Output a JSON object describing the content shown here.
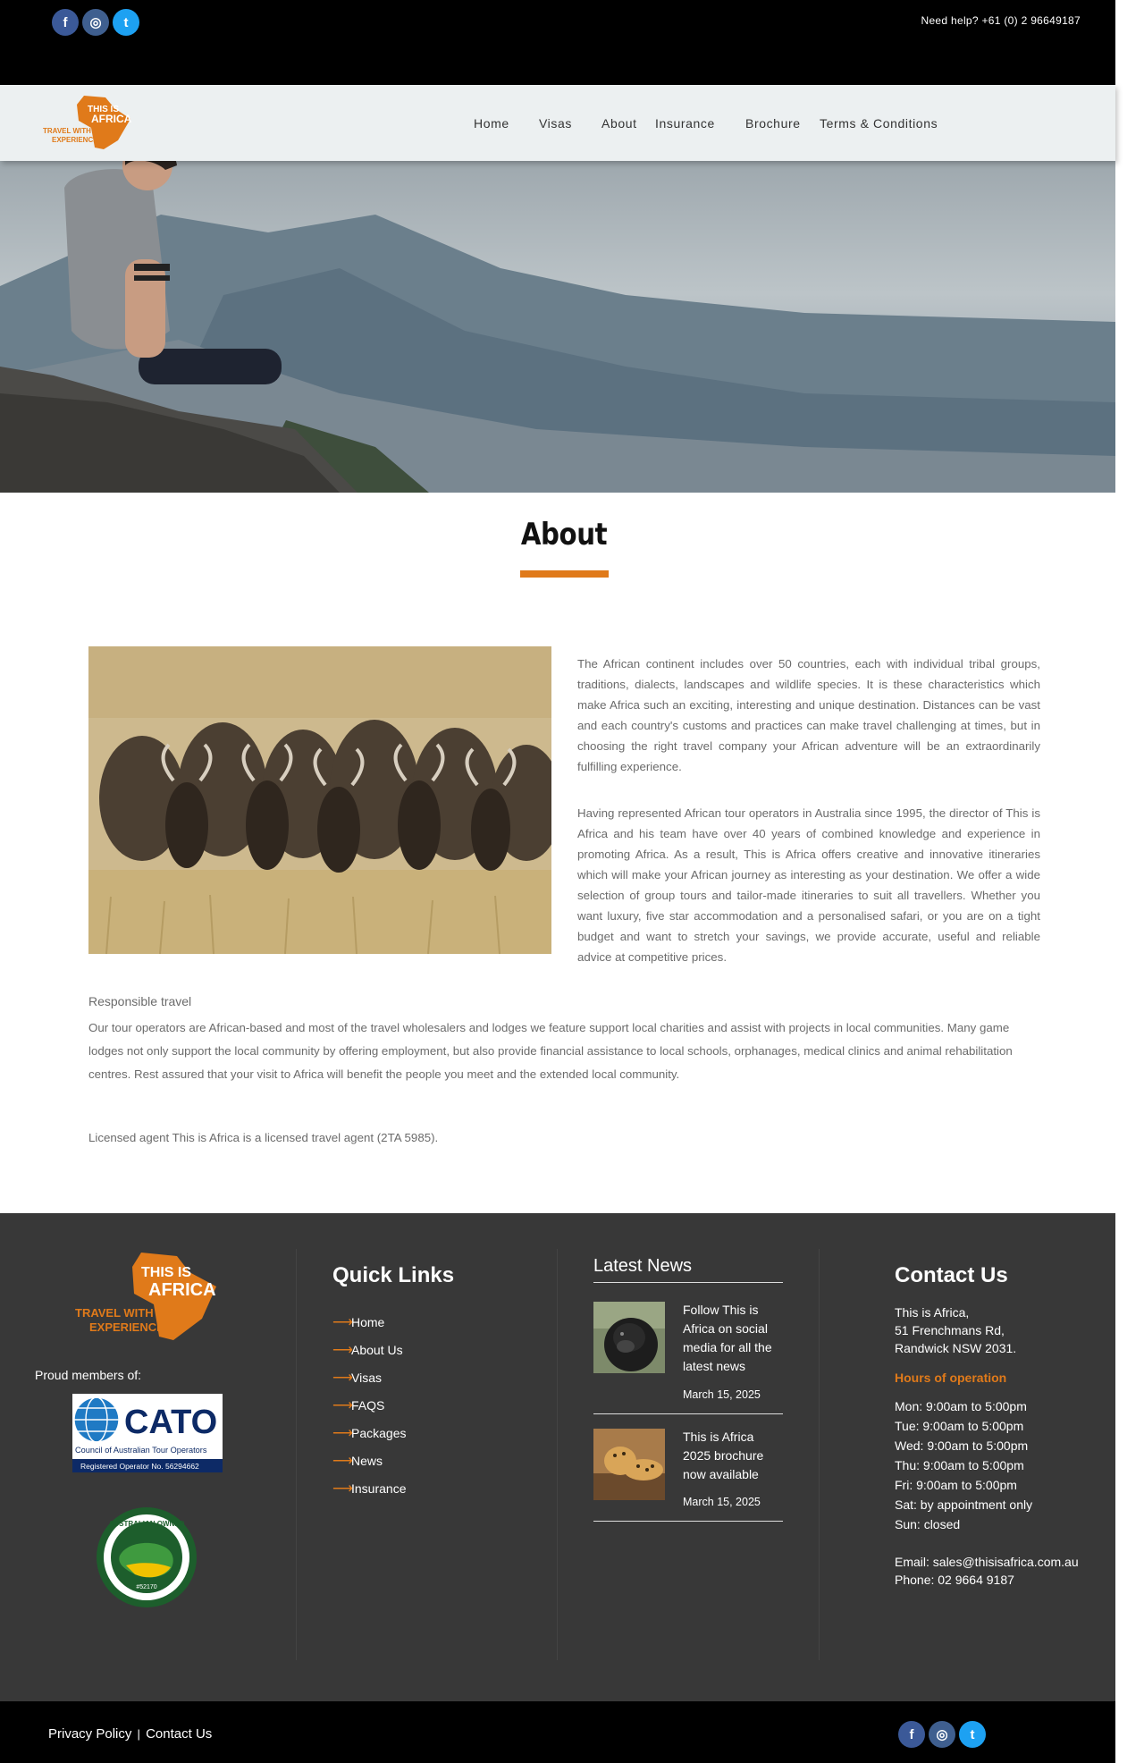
{
  "topbar": {
    "social": [
      {
        "icon": "facebook-icon",
        "glyph": "f"
      },
      {
        "icon": "instagram-icon",
        "glyph": "◎"
      },
      {
        "icon": "twitter-icon",
        "glyph": "t"
      }
    ],
    "help_text": "Need help? +61 (0) 2 96649187"
  },
  "brand": {
    "logo_line1": "THIS IS",
    "logo_line2": "AFRICA",
    "tagline1": "TRAVEL WITH",
    "tagline2": "EXPERIENCE",
    "accent": "#e07a1a"
  },
  "nav": {
    "items": [
      "Home",
      "Visas",
      "About",
      "Insurance",
      "Brochure",
      "Terms & Conditions"
    ]
  },
  "about": {
    "title": "About",
    "p1": "The African continent includes over 50 countries, each with individual tribal groups, traditions, dialects, landscapes and wildlife species. It is these characteristics which make Africa such an exciting, interesting and unique destination. Distances can be vast and each country's customs and practices can make travel challenging at times, but in choosing the right travel company your African adventure will be an extraordinarily fulfilling experience.",
    "p2": "Having represented African tour operators in Australia since 1995, the director of This is Africa and his team have over 40 years of combined knowledge and experience in promoting Africa. As a result, This is Africa offers creative and innovative itineraries which will make your African journey as interesting as your destination. We offer a wide selection of group tours and tailor-made itineraries to suit all travellers. Whether you want luxury, five star accommodation and a personalised safari, or you are on a tight budget and want to stretch your savings, we provide accurate, useful and reliable advice at competitive prices.",
    "resp_title": "Responsible travel",
    "resp_text": "Our tour operators are African-based and most of the travel wholesalers and lodges we feature support local charities and assist with projects in local communities. Many game lodges not only support the local community by offering employment, but also provide financial assistance to local schools, orphanages, medical clinics and animal rehabilitation centres. Rest assured that your visit to Africa will benefit the people you meet and the extended local community.",
    "license": "Licensed agent This is Africa is a licensed travel agent (2TA 5985)."
  },
  "footer": {
    "proud": "Proud members of:",
    "cato": {
      "name": "CATO",
      "full": "Council of Australian Tour Operators",
      "reg": "Registered Operator No. 56294662"
    },
    "aus_badge": {
      "text": "AUSTRALIAN OWNED",
      "number": "#52170"
    },
    "quick_title": "Quick Links",
    "quick_links": [
      "Home",
      "About Us",
      "Visas",
      "FAQS",
      "Packages",
      "News",
      "Insurance"
    ],
    "news_title": "Latest News",
    "news": [
      {
        "title": "Follow This is Africa on social media for all the latest news",
        "date": "March 15, 2025",
        "thumb": "gorilla"
      },
      {
        "title": "This is Africa 2025 brochure now available",
        "date": "March 15, 2025",
        "thumb": "leopard"
      }
    ],
    "contact_title": "Contact Us",
    "address": [
      "This is Africa,",
      "51 Frenchmans Rd,",
      "Randwick NSW 2031."
    ],
    "hours_title": "Hours of operation",
    "hours": [
      "Mon: 9:00am to 5:00pm",
      "Tue: 9:00am to 5:00pm",
      "Wed: 9:00am to 5:00pm",
      "Thu: 9:00am to 5:00pm",
      "Fri: 9:00am to 5:00pm",
      "Sat: by appointment only",
      "Sun: closed"
    ],
    "email": "Email: sales@thisisafrica.com.au",
    "phone": "Phone: 02 9664 9187"
  },
  "bottom": {
    "privacy": "Privacy Policy",
    "sep": "|",
    "contact": "Contact Us"
  }
}
